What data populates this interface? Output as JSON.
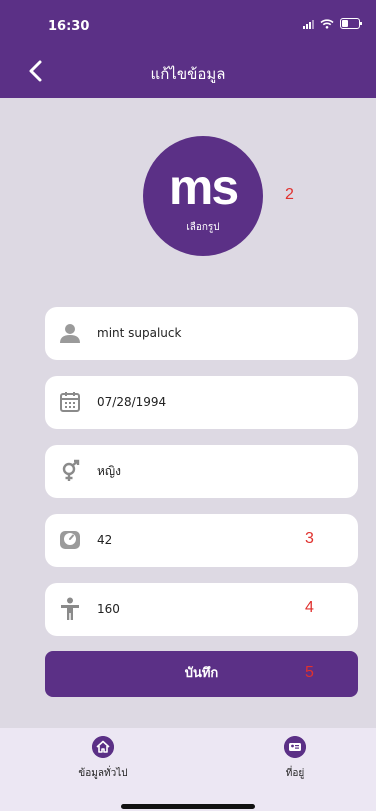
{
  "status": {
    "time": "16:30"
  },
  "header": {
    "title": "แก้ไขข้อมูล"
  },
  "avatar": {
    "initials": "ms",
    "caption": "เลือกรูป"
  },
  "annotations": {
    "a2": "2",
    "a3": "3",
    "a4": "4",
    "a5": "5"
  },
  "fields": {
    "name": "mint supaluck",
    "birthdate": "07/28/1994",
    "gender": "หญิง",
    "weight": "42",
    "height": "160"
  },
  "actions": {
    "save_label": "บันทึก"
  },
  "bottom_nav": {
    "tab1_label": "ข้อมูลทั่วไป",
    "tab2_label": "ที่อยู่"
  },
  "colors": {
    "primary": "#5b3086",
    "background": "#ddd9e3",
    "annotation": "#e0312e"
  },
  "icons": {
    "back": "chevron-left-icon",
    "name": "person-icon",
    "birthdate": "calendar-icon",
    "gender": "gender-icon",
    "weight": "scale-icon",
    "height": "body-icon",
    "tab1": "home-icon",
    "tab2": "id-card-icon"
  }
}
